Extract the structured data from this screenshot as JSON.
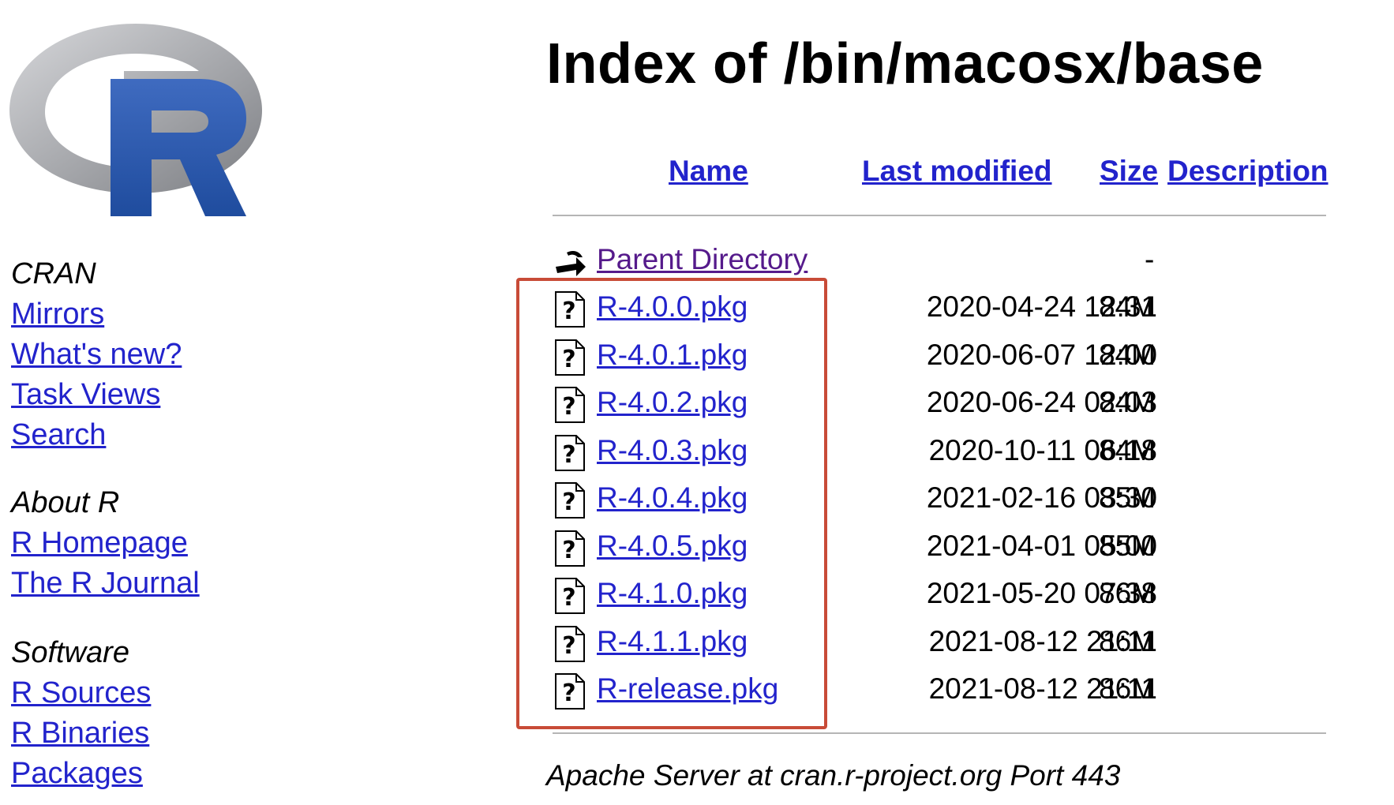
{
  "sidebar": {
    "cran": {
      "heading": "CRAN",
      "links": [
        "Mirrors",
        "What's new?",
        "Task Views",
        "Search"
      ]
    },
    "about": {
      "heading": "About R",
      "links": [
        "R Homepage",
        "The R Journal"
      ]
    },
    "software": {
      "heading": "Software",
      "links": [
        "R Sources",
        "R Binaries",
        "Packages"
      ]
    }
  },
  "page": {
    "title": "Index of /bin/macosx/base",
    "columns": {
      "name": "Name",
      "last_modified": "Last modified",
      "size": "Size",
      "description": "Description"
    },
    "parent": {
      "label": "Parent Directory",
      "size": "-"
    },
    "files": [
      {
        "name": "R-4.0.0.pkg",
        "modified": "2020-04-24 12:31",
        "size": "84M"
      },
      {
        "name": "R-4.0.1.pkg",
        "modified": "2020-06-07 12:00",
        "size": "84M"
      },
      {
        "name": "R-4.0.2.pkg",
        "modified": "2020-06-24 02:03",
        "size": "84M"
      },
      {
        "name": "R-4.0.3.pkg",
        "modified": "2020-10-11 06:18",
        "size": "84M"
      },
      {
        "name": "R-4.0.4.pkg",
        "modified": "2021-02-16 03:30",
        "size": "85M"
      },
      {
        "name": "R-4.0.5.pkg",
        "modified": "2021-04-01 05:00",
        "size": "85M"
      },
      {
        "name": "R-4.1.0.pkg",
        "modified": "2021-05-20 07:38",
        "size": "86M"
      },
      {
        "name": "R-4.1.1.pkg",
        "modified": "2021-08-12 21:11",
        "size": "86M"
      },
      {
        "name": "R-release.pkg",
        "modified": "2021-08-12 21:11",
        "size": "86M"
      }
    ],
    "footer": "Apache Server at cran.r-project.org Port 443"
  },
  "colors": {
    "link": "#2223cc",
    "visited": "#551a8b",
    "highlight": "#c84b37",
    "logo_blue": "#2a5bb0"
  }
}
